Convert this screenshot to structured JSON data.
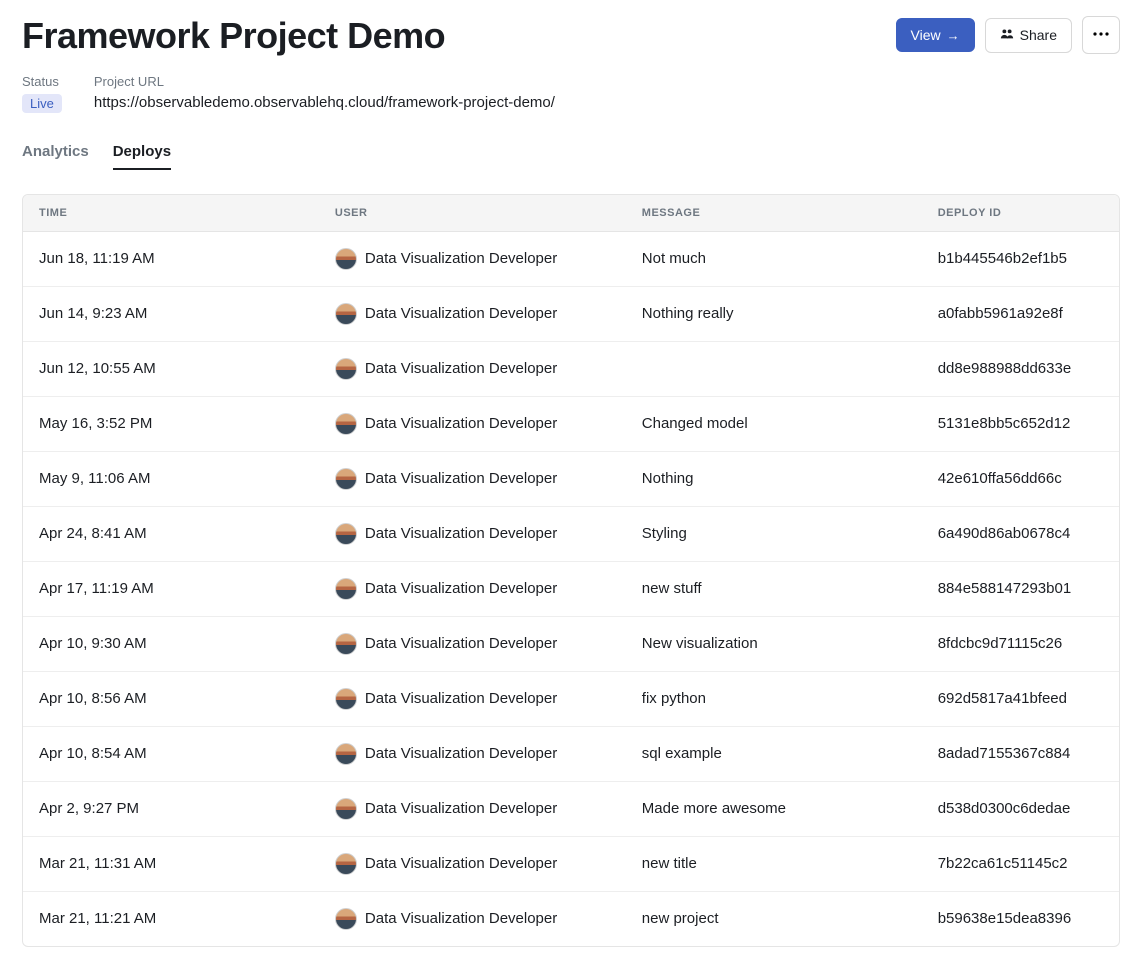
{
  "header": {
    "title": "Framework Project Demo",
    "view_label": "View",
    "share_label": "Share"
  },
  "meta": {
    "status_label": "Status",
    "status_value": "Live",
    "url_label": "Project URL",
    "url_value": "https://observabledemo.observablehq.cloud/framework-project-demo/"
  },
  "tabs": {
    "analytics": "Analytics",
    "deploys": "Deploys"
  },
  "table": {
    "headers": {
      "time": "TIME",
      "user": "USER",
      "message": "MESSAGE",
      "deploy_id": "DEPLOY ID"
    },
    "rows": [
      {
        "time": "Jun 18, 11:19 AM",
        "user": "Data Visualization Developer",
        "message": "Not much",
        "deploy_id": "b1b445546b2ef1b5"
      },
      {
        "time": "Jun 14, 9:23 AM",
        "user": "Data Visualization Developer",
        "message": "Nothing really",
        "deploy_id": "a0fabb5961a92e8f"
      },
      {
        "time": "Jun 12, 10:55 AM",
        "user": "Data Visualization Developer",
        "message": "",
        "deploy_id": "dd8e988988dd633e"
      },
      {
        "time": "May 16, 3:52 PM",
        "user": "Data Visualization Developer",
        "message": "Changed model",
        "deploy_id": "5131e8bb5c652d12"
      },
      {
        "time": "May 9, 11:06 AM",
        "user": "Data Visualization Developer",
        "message": "Nothing",
        "deploy_id": "42e610ffa56dd66c"
      },
      {
        "time": "Apr 24, 8:41 AM",
        "user": "Data Visualization Developer",
        "message": "Styling",
        "deploy_id": "6a490d86ab0678c4"
      },
      {
        "time": "Apr 17, 11:19 AM",
        "user": "Data Visualization Developer",
        "message": "new stuff",
        "deploy_id": "884e588147293b01"
      },
      {
        "time": "Apr 10, 9:30 AM",
        "user": "Data Visualization Developer",
        "message": "New visualization",
        "deploy_id": "8fdcbc9d71115c26"
      },
      {
        "time": "Apr 10, 8:56 AM",
        "user": "Data Visualization Developer",
        "message": "fix python",
        "deploy_id": "692d5817a41bfeed"
      },
      {
        "time": "Apr 10, 8:54 AM",
        "user": "Data Visualization Developer",
        "message": "sql example",
        "deploy_id": "8adad7155367c884"
      },
      {
        "time": "Apr 2, 9:27 PM",
        "user": "Data Visualization Developer",
        "message": "Made more awesome",
        "deploy_id": "d538d0300c6dedae"
      },
      {
        "time": "Mar 21, 11:31 AM",
        "user": "Data Visualization Developer",
        "message": "new title",
        "deploy_id": "7b22ca61c51145c2"
      },
      {
        "time": "Mar 21, 11:21 AM",
        "user": "Data Visualization Developer",
        "message": "new project",
        "deploy_id": "b59638e15dea8396"
      }
    ]
  }
}
